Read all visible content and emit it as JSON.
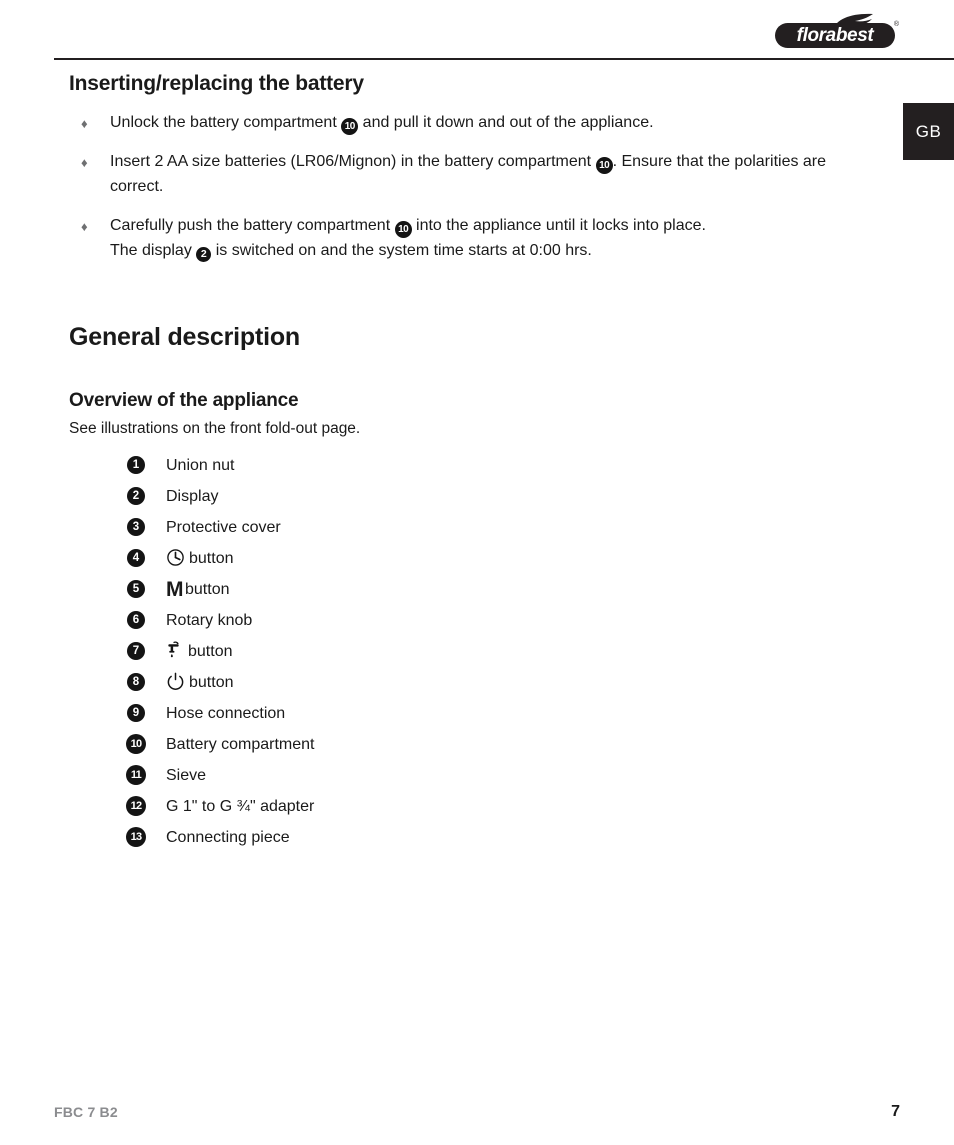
{
  "brand": {
    "name": "florabest",
    "leaf_icon": "leaf-icon",
    "registered_mark": "®"
  },
  "language_tab": {
    "label": "GB"
  },
  "sections": [
    {
      "id": "inserting-replacing-battery",
      "heading": "Inserting/replacing the battery",
      "bullets": [
        {
          "parts": [
            {
              "type": "text",
              "value": "Unlock the battery compartment "
            },
            {
              "type": "badge",
              "value": "10"
            },
            {
              "type": "text",
              "value": " and pull it down and out of the appliance."
            }
          ]
        },
        {
          "parts": [
            {
              "type": "text",
              "value": "Insert 2 AA size batteries (LR06/Mignon) in the battery compartment "
            },
            {
              "type": "badge",
              "value": "10"
            },
            {
              "type": "text",
              "value": ". Ensure that the polarities are correct."
            }
          ]
        },
        {
          "parts": [
            {
              "type": "text",
              "value": "Carefully push the battery compartment "
            },
            {
              "type": "badge",
              "value": "10"
            },
            {
              "type": "text",
              "value": " into the appliance until it locks into place."
            }
          ],
          "second_line": [
            {
              "type": "text",
              "value": "The display "
            },
            {
              "type": "badge",
              "value": "2"
            },
            {
              "type": "text",
              "value": " is switched on and the system time starts at 0:00 hrs."
            }
          ]
        }
      ]
    }
  ],
  "general_description": {
    "heading": "General description",
    "overview_heading": "Overview of the appliance",
    "overview_note": "See illustrations on the front fold-out page.",
    "parts_list": [
      {
        "num": "1",
        "label": "Union nut",
        "icon": null
      },
      {
        "num": "2",
        "label": "Display",
        "icon": null
      },
      {
        "num": "3",
        "label": "Protective cover",
        "icon": null
      },
      {
        "num": "4",
        "label": "button",
        "icon": "clock-icon"
      },
      {
        "num": "5",
        "label": "button",
        "icon": "letter-m-glyph"
      },
      {
        "num": "6",
        "label": "Rotary knob",
        "icon": null
      },
      {
        "num": "7",
        "label": "button",
        "icon": "faucet-drop-icon"
      },
      {
        "num": "8",
        "label": "button",
        "icon": "power-icon"
      },
      {
        "num": "9",
        "label": "Hose connection",
        "icon": null
      },
      {
        "num": "10",
        "label": "Battery compartment",
        "icon": null
      },
      {
        "num": "11",
        "label": "Sieve",
        "icon": null
      },
      {
        "num": "12",
        "label": "G 1\" to G ¾\" adapter",
        "icon": null
      },
      {
        "num": "13",
        "label": "Connecting piece",
        "icon": null
      }
    ]
  },
  "footer": {
    "model": "FBC 7 B2",
    "page_number": "7"
  },
  "colors": {
    "ink": "#1a1a1a",
    "badge_fill": "#141414",
    "bullet_gray": "#6f7072",
    "footer_gray": "#8b8c8f",
    "tab_fill": "#231f20"
  }
}
